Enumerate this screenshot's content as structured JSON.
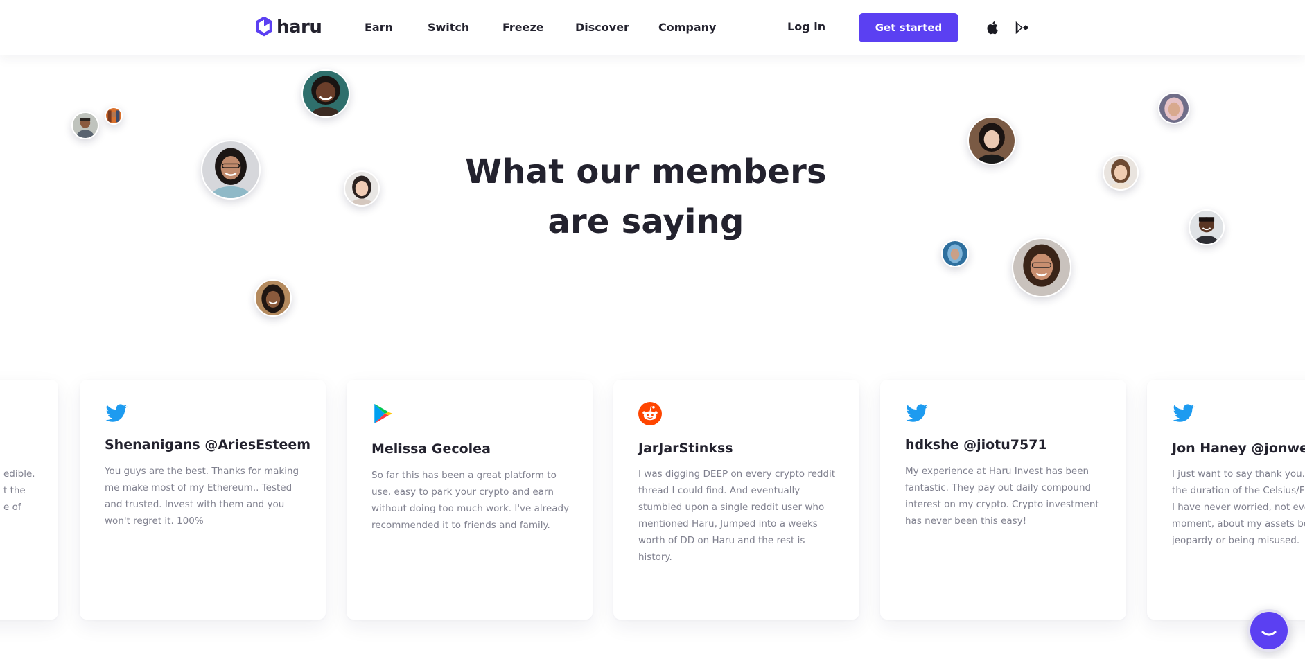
{
  "header": {
    "logo_text": "haru",
    "nav": [
      "Earn",
      "Switch",
      "Freeze",
      "Discover",
      "Company"
    ],
    "login_label": "Log in",
    "cta_label": "Get started"
  },
  "hero": {
    "title_line1": "What our members",
    "title_line2": "are saying"
  },
  "testimonials": [
    {
      "source": "twitter",
      "author": "",
      "text_lines": [
        "edible.",
        "t the",
        "e of"
      ]
    },
    {
      "source": "twitter",
      "author": "Shenanigans @AriesEsteem",
      "text": "You guys are the best. Thanks for making me make most of my Ethereum.. Tested and trusted. Invest with them and you won't regret it. 100%"
    },
    {
      "source": "google-play",
      "author": "Melissa Gecolea",
      "text": "So far this has been a great platform to use, easy to park your crypto and earn without doing too much work. I've already recommended it to friends and family."
    },
    {
      "source": "reddit",
      "author": "JarJarStinkss",
      "text": "I was digging DEEP on every crypto reddit thread I could find. And eventually stumbled upon a single reddit user who mentioned Haru, Jumped into a weeks worth of DD on Haru and the rest is history."
    },
    {
      "source": "twitter",
      "author": "hdkshe @jiotu7571",
      "text": "My experience at Haru Invest has been fantastic. They pay out daily compound interest on my crypto. Crypto investment has never been this easy!"
    },
    {
      "source": "twitter",
      "author": "Jon Haney @jonwes",
      "text_lines": [
        "I just want to say thank you.",
        "the duration of the Celsius/F",
        "I have never worried, not eve",
        "moment, about my assets be",
        "jeopardy or being misused."
      ]
    }
  ],
  "colors": {
    "accent": "#5b40f2",
    "text": "#23222e",
    "muted": "#80818f",
    "twitter": "#1d9bf0",
    "reddit": "#ff4500"
  },
  "icons": {
    "apple": "apple-icon",
    "google_play": "google-play-icon",
    "chat": "chat-icon"
  }
}
